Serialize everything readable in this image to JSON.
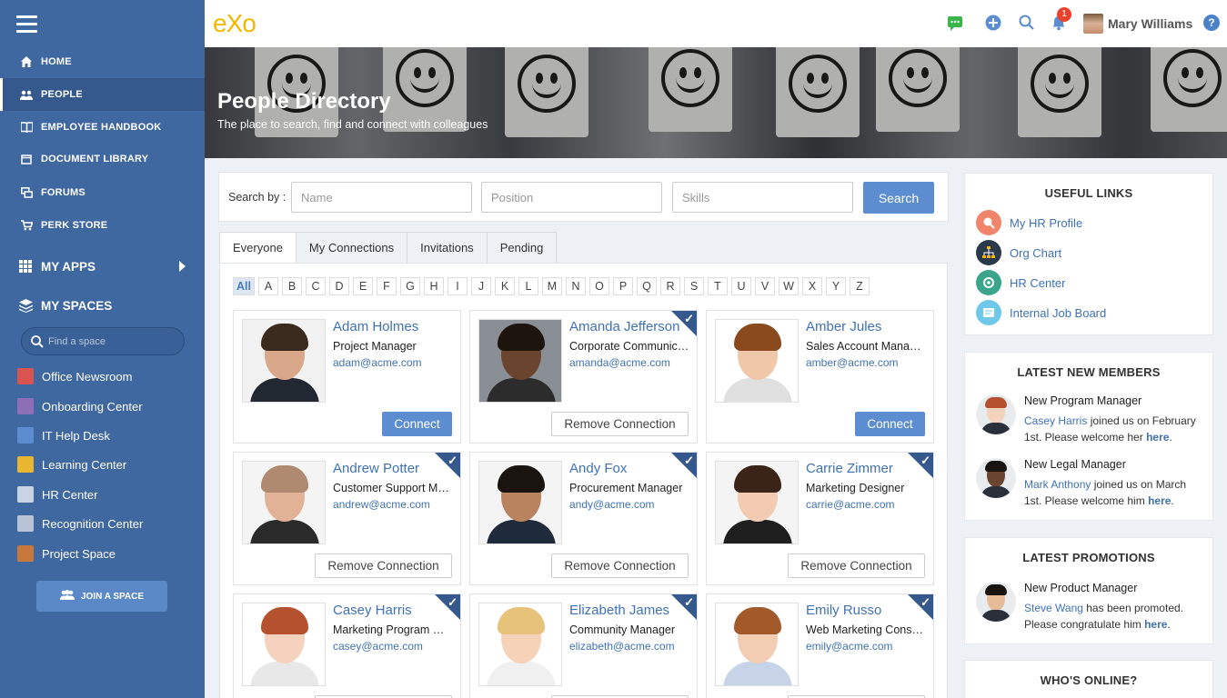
{
  "app": {
    "logo": "eXo"
  },
  "sidebar": {
    "nav": [
      {
        "label": "HOME",
        "icon": "home-icon"
      },
      {
        "label": "PEOPLE",
        "icon": "people-icon",
        "active": true
      },
      {
        "label": "EMPLOYEE HANDBOOK",
        "icon": "book-icon"
      },
      {
        "label": "DOCUMENT LIBRARY",
        "icon": "document-icon"
      },
      {
        "label": "FORUMS",
        "icon": "forum-icon"
      },
      {
        "label": "PERK STORE",
        "icon": "cart-icon"
      }
    ],
    "my_apps": "MY APPS",
    "my_spaces": "MY SPACES",
    "find_space_placeholder": "Find a space",
    "spaces": [
      {
        "label": "Office Newsroom",
        "color": "#d9534f"
      },
      {
        "label": "Onboarding Center",
        "color": "#8e6fb7"
      },
      {
        "label": "IT Help Desk",
        "color": "#5b8dd0"
      },
      {
        "label": "Learning Center",
        "color": "#e8b630"
      },
      {
        "label": "HR Center",
        "color": "#c9d3e3"
      },
      {
        "label": "Recognition Center",
        "color": "#b8c3d6"
      },
      {
        "label": "Project Space",
        "color": "#c7783a"
      }
    ],
    "join_space": "JOIN A SPACE"
  },
  "topbar": {
    "notification_count": "1",
    "user_name": "Mary Williams",
    "help": "?"
  },
  "banner": {
    "title": "People Directory",
    "subtitle": "The place to search, find and connect with colleagues"
  },
  "search": {
    "label": "Search by :",
    "name_placeholder": "Name",
    "position_placeholder": "Position",
    "skills_placeholder": "Skills",
    "button": "Search"
  },
  "tabs": [
    "Everyone",
    "My Connections",
    "Invitations",
    "Pending"
  ],
  "letters": [
    "All",
    "A",
    "B",
    "C",
    "D",
    "E",
    "F",
    "G",
    "H",
    "I",
    "J",
    "K",
    "L",
    "M",
    "N",
    "O",
    "P",
    "Q",
    "R",
    "S",
    "T",
    "U",
    "V",
    "W",
    "X",
    "Y",
    "Z"
  ],
  "people": [
    {
      "name": "Adam Holmes",
      "position": "Project Manager",
      "email": "adam@acme.com",
      "action": "Connect",
      "connected": false,
      "skin": "#d9a88a",
      "hair": "#3a2a1e",
      "shirt": "#222831",
      "bg": "#f2f2f2"
    },
    {
      "name": "Amanda Jefferson",
      "position": "Corporate Communications",
      "email": "amanda@acme.com",
      "action": "Remove Connection",
      "connected": true,
      "skin": "#6b4430",
      "hair": "#1e140e",
      "shirt": "#2c2c2c",
      "bg": "#8a8f95"
    },
    {
      "name": "Amber Jules",
      "position": "Sales Account Manager",
      "email": "amber@acme.com",
      "action": "Connect",
      "connected": false,
      "skin": "#f0c7a8",
      "hair": "#8a4a1e",
      "shirt": "#e0e0e0",
      "bg": "#ffffff"
    },
    {
      "name": "Andrew Potter",
      "position": "Customer Support Manager",
      "email": "andrew@acme.com",
      "action": "Remove Connection",
      "connected": true,
      "skin": "#e2b297",
      "hair": "#b08a70",
      "shirt": "#2a2a2a",
      "bg": "#f4f4f4"
    },
    {
      "name": "Andy Fox",
      "position": "Procurement Manager",
      "email": "andy@acme.com",
      "action": "Remove Connection",
      "connected": true,
      "skin": "#b8835e",
      "hair": "#1a1410",
      "shirt": "#1f2a3a",
      "bg": "#f4f4f4"
    },
    {
      "name": "Carrie Zimmer",
      "position": "Marketing Designer",
      "email": "carrie@acme.com",
      "action": "Remove Connection",
      "connected": true,
      "skin": "#f2cbb2",
      "hair": "#3a2418",
      "shirt": "#1e1e1e",
      "bg": "#f4f4f4"
    },
    {
      "name": "Casey Harris",
      "position": "Marketing Program Manager",
      "email": "casey@acme.com",
      "action": "Remove Connection",
      "connected": true,
      "skin": "#f4d2bd",
      "hair": "#b5512e",
      "shirt": "#e8e8e8",
      "bg": "#ffffff"
    },
    {
      "name": "Elizabeth James",
      "position": "Community Manager",
      "email": "elizabeth@acme.com",
      "action": "Remove Connection",
      "connected": true,
      "skin": "#f6d3b8",
      "hair": "#e6c27a",
      "shirt": "#f0f0f0",
      "bg": "#ffffff"
    },
    {
      "name": "Emily Russo",
      "position": "Web Marketing Consultant",
      "email": "emily@acme.com",
      "action": "Remove Connection",
      "connected": true,
      "skin": "#f3cdb3",
      "hair": "#a25a2a",
      "shirt": "#c7d4e8",
      "bg": "#ffffff"
    }
  ],
  "useful_links": {
    "title": "USEFUL LINKS",
    "items": [
      {
        "label": "My HR Profile",
        "color": "#f0856b",
        "icon": "hr-profile-icon"
      },
      {
        "label": "Org Chart",
        "color": "#2a3a4a",
        "icon": "org-chart-icon"
      },
      {
        "label": "HR Center",
        "color": "#3aa58a",
        "icon": "hr-center-icon"
      },
      {
        "label": "Internal Job Board",
        "color": "#6fc8ea",
        "icon": "job-board-icon"
      }
    ]
  },
  "latest_members": {
    "title": "LATEST NEW MEMBERS",
    "items": [
      {
        "title": "New Program Manager",
        "name": "Casey Harris",
        "text1": " joined us on February 1st. Please welcome her ",
        "link": "here",
        "text2": ".",
        "skin": "#f4d2bd",
        "hair": "#b5512e"
      },
      {
        "title": "New Legal Manager",
        "name": "Mark Anthony",
        "text1": " joined us on March 1st. Please welcome him ",
        "link": "here",
        "text2": ".",
        "skin": "#6b4430",
        "hair": "#1a1410"
      }
    ]
  },
  "latest_promotions": {
    "title": "LATEST PROMOTIONS",
    "items": [
      {
        "title": "New Product Manager",
        "name": "Steve Wang",
        "text1": " has been promoted. Please congratulate him ",
        "link": "here",
        "text2": ".",
        "skin": "#e6bb97",
        "hair": "#1a1410"
      }
    ]
  },
  "whos_online": {
    "title": "WHO'S ONLINE?"
  },
  "colors": {
    "sidebar": "#3f67a0",
    "accent": "#5b8dd0",
    "link": "#3f72b5",
    "badge": "#e8412c"
  }
}
